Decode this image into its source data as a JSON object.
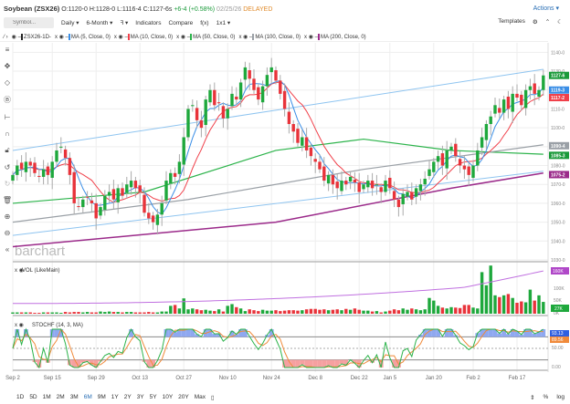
{
  "header": {
    "symbol": "Soybean (ZSX26)",
    "ohlc": "O:1120-0 H:1128-0 L:1116-4 C:1127-6s",
    "change": "+6-4 (+0.58%)",
    "date": "02/25/26",
    "status": "DELAYED",
    "actions": "Actions ▾"
  },
  "toolbar": {
    "search_placeholder": "Symbol...",
    "period": "Daily ▾",
    "range": "6-Month ▾",
    "type": "ꟻ ▾",
    "indicators": "Indicators",
    "compare": "Compare",
    "fx": "f(x)",
    "layout": "1x1 ▾",
    "templates": "Templates"
  },
  "legend": [
    {
      "label": "ZSX26-1D-",
      "color": "#222"
    },
    {
      "label": "MA (5, Close, 0)",
      "color": "#3a8ee6"
    },
    {
      "label": "MA (10, Close, 0)",
      "color": "#f0404a"
    },
    {
      "label": "MA (50, Close, 0)",
      "color": "#2bb34a"
    },
    {
      "label": "MA (100, Close, 0)",
      "color": "#9aa0a6"
    },
    {
      "label": "MA (200, Close, 0)",
      "color": "#9b2a8a"
    }
  ],
  "watermark": "barchart",
  "range_buttons": [
    "1D",
    "5D",
    "1M",
    "2M",
    "3M",
    "6M",
    "9M",
    "1Y",
    "2Y",
    "3Y",
    "5Y",
    "10Y",
    "20Y",
    "Max"
  ],
  "range_selected": "6M",
  "bottom_right": {
    "pct": "%",
    "log": "log"
  },
  "chart_data": {
    "type": "candlestick",
    "price_axis": {
      "ticks": [
        "1140-0",
        "1130-0",
        "1120-0",
        "1110-0",
        "1100-0",
        "1090-0",
        "1080-0",
        "1070-0",
        "1060-0",
        "1050-0",
        "1040-0",
        "1030-0"
      ],
      "ylim": [
        1030,
        1145
      ]
    },
    "x_ticks": [
      {
        "label": "Sep 2",
        "index": 0
      },
      {
        "label": "Sep 15",
        "index": 9
      },
      {
        "label": "Sep 29",
        "index": 19
      },
      {
        "label": "Oct 13",
        "index": 29
      },
      {
        "label": "Oct 27",
        "index": 39
      },
      {
        "label": "Nov 10",
        "index": 49
      },
      {
        "label": "Nov 24",
        "index": 59
      },
      {
        "label": "Dec 8",
        "index": 69
      },
      {
        "label": "Dec 22",
        "index": 79
      },
      {
        "label": "Jan 5",
        "index": 86
      },
      {
        "label": "Jan 20",
        "index": 96
      },
      {
        "label": "Feb 2",
        "index": 105
      },
      {
        "label": "Feb 17",
        "index": 115
      }
    ],
    "closes": [
      1075,
      1080,
      1078,
      1082,
      1080,
      1076,
      1074,
      1078,
      1075,
      1082,
      1088,
      1090,
      1084,
      1075,
      1060,
      1058,
      1062,
      1063,
      1060,
      1052,
      1058,
      1064,
      1066,
      1062,
      1068,
      1064,
      1070,
      1072,
      1068,
      1066,
      1055,
      1052,
      1050,
      1054,
      1060,
      1072,
      1076,
      1074,
      1082,
      1095,
      1110,
      1112,
      1104,
      1100,
      1115,
      1120,
      1112,
      1113,
      1105,
      1110,
      1118,
      1115,
      1124,
      1132,
      1126,
      1120,
      1115,
      1122,
      1128,
      1132,
      1125,
      1118,
      1110,
      1102,
      1098,
      1092,
      1095,
      1088,
      1085,
      1082,
      1078,
      1072,
      1075,
      1070,
      1068,
      1072,
      1070,
      1074,
      1071,
      1066,
      1070,
      1072,
      1068,
      1070,
      1066,
      1072,
      1068,
      1062,
      1058,
      1065,
      1066,
      1062,
      1068,
      1070,
      1073,
      1078,
      1082,
      1085,
      1080,
      1088,
      1090,
      1085,
      1080,
      1078,
      1075,
      1080,
      1088,
      1095,
      1102,
      1106,
      1112,
      1108,
      1115,
      1110,
      1118,
      1116,
      1112,
      1120,
      1122,
      1118,
      1120,
      1127.75
    ],
    "ma_long": {
      "ma50": [
        [
          0,
          1060
        ],
        [
          30,
          1066
        ],
        [
          60,
          1088
        ],
        [
          80,
          1094
        ],
        [
          100,
          1088
        ],
        [
          121,
          1086
        ]
      ],
      "ma100": [
        [
          0,
          1050
        ],
        [
          40,
          1062
        ],
        [
          80,
          1078
        ],
        [
          121,
          1091
        ]
      ],
      "ma200": [
        [
          0,
          1037
        ],
        [
          60,
          1050
        ],
        [
          100,
          1068
        ],
        [
          121,
          1076
        ]
      ]
    },
    "trendlines": [
      {
        "from": [
          0,
          1088
        ],
        "to": [
          121,
          1131
        ]
      },
      {
        "from": [
          0,
          1043
        ],
        "to": [
          121,
          1077
        ]
      }
    ],
    "price_labels": [
      {
        "text": "1127-6",
        "color": "#1a9a3a",
        "value": 1127.75
      },
      {
        "text": "1119-3",
        "color": "#3a8ee6",
        "value": 1120
      },
      {
        "text": "1117-2",
        "color": "#f0404a",
        "value": 1116
      },
      {
        "text": "1090-4",
        "color": "#9aa0a6",
        "value": 1090.5
      },
      {
        "text": "1085-3",
        "color": "#1a9a3a",
        "value": 1085.4
      },
      {
        "text": "1075-2",
        "color": "#9b2a8a",
        "value": 1075.2
      }
    ],
    "volume": {
      "label": "VOL (LikeMain)",
      "ticks": [
        "100K",
        "50K",
        "0K"
      ],
      "current": "27K",
      "oi_label": "160K",
      "values": [
        3,
        3,
        3,
        3,
        3,
        2,
        2,
        3,
        3,
        3,
        3,
        2,
        4,
        3,
        4,
        4,
        3,
        4,
        3,
        3,
        5,
        4,
        5,
        4,
        4,
        3,
        4,
        4,
        3,
        3,
        3,
        4,
        3,
        3,
        5,
        5,
        18,
        20,
        12,
        35,
        10,
        12,
        10,
        8,
        9,
        7,
        6,
        10,
        5,
        18,
        22,
        15,
        12,
        6,
        10,
        8,
        6,
        9,
        7,
        7,
        8,
        6,
        7,
        8,
        8,
        7,
        8,
        10,
        11,
        11,
        9,
        10,
        8,
        9,
        10,
        8,
        11,
        9,
        12,
        9,
        7,
        7,
        5,
        6,
        3,
        5,
        7,
        10,
        8,
        12,
        9,
        12,
        10,
        8,
        10,
        36,
        30,
        18,
        14,
        12,
        15,
        14,
        13,
        20,
        20,
        14,
        12,
        95,
        65,
        110,
        42,
        38,
        42,
        45,
        36,
        25,
        28,
        26,
        55,
        30,
        42,
        27
      ],
      "open_interest": [
        30,
        160
      ]
    },
    "stoch": {
      "label": "STOCHF (14, 3, MA)",
      "ticks": [
        "50.00",
        "0.00"
      ],
      "k_value": "93.13",
      "d_value": "89.56"
    }
  }
}
